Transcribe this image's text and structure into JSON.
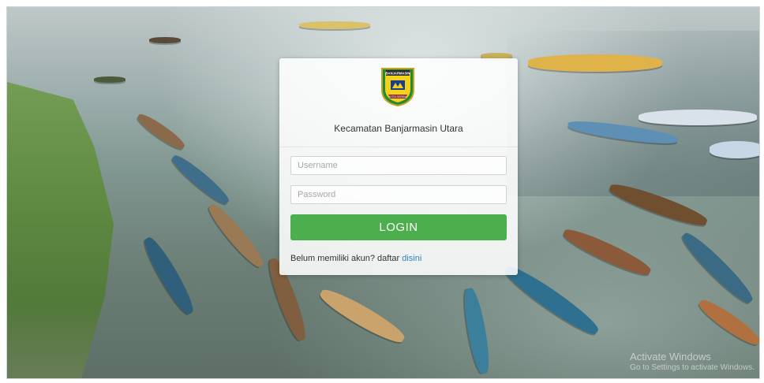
{
  "card": {
    "subtitle": "Kecamatan Banjarmasin Utara",
    "logo_text_top": "BANJARMASIN",
    "logo_text_bottom": "KOTA SERIBU"
  },
  "form": {
    "username_placeholder": "Username",
    "password_placeholder": "Password",
    "login_label": "LOGIN"
  },
  "register": {
    "prompt": "Belum memiliki akun? daftar ",
    "link_label": "disini"
  },
  "watermark": {
    "line1": "Activate Windows",
    "line2": "Go to Settings to activate Windows."
  },
  "colors": {
    "login_button": "#4cae4c",
    "link": "#2f7fc1"
  }
}
